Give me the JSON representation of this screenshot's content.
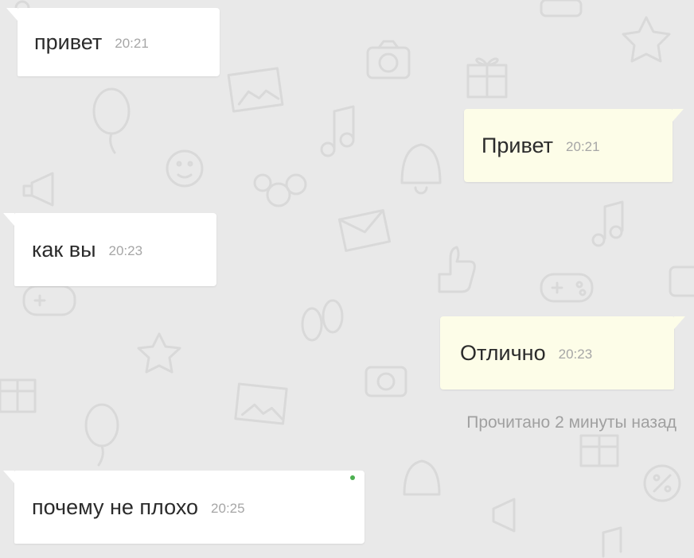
{
  "messages": [
    {
      "direction": "incoming",
      "text": "привет",
      "time": "20:21"
    },
    {
      "direction": "outgoing",
      "text": "Привет",
      "time": "20:21"
    },
    {
      "direction": "incoming",
      "text": "как вы",
      "time": "20:23"
    },
    {
      "direction": "outgoing",
      "text": "Отлично",
      "time": "20:23"
    },
    {
      "direction": "incoming",
      "text": "почему не плохо",
      "time": "20:25"
    }
  ],
  "read_status": "Прочитано 2 минуты назад",
  "colors": {
    "background": "#e9e9e9",
    "incoming_bubble": "#ffffff",
    "outgoing_bubble": "#fdfde8",
    "online_indicator": "#4caf50"
  }
}
